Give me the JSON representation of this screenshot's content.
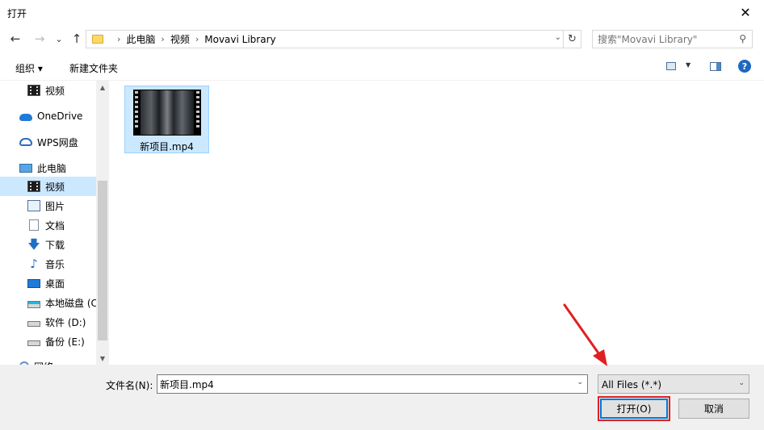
{
  "window": {
    "title": "打开",
    "close_glyph": "✕"
  },
  "nav": {
    "back_glyph": "←",
    "forward_glyph": "→",
    "recent_glyph": "⌄",
    "up_glyph": "↑",
    "breadcrumbs": [
      "此电脑",
      "视频",
      "Movavi Library"
    ],
    "refresh_glyph": "↻"
  },
  "search": {
    "placeholder": "搜索\"Movavi Library\"",
    "icon": "search-icon"
  },
  "toolbar": {
    "organize_label": "组织 ▾",
    "new_folder_label": "新建文件夹",
    "help_glyph": "?"
  },
  "sidebar": {
    "items": [
      {
        "label": "视频",
        "icon": "video-icon"
      },
      {
        "label": "OneDrive",
        "icon": "cloud-icon"
      },
      {
        "label": "WPS网盘",
        "icon": "wps-cloud-icon"
      },
      {
        "label": "此电脑",
        "icon": "computer-icon"
      },
      {
        "label": "视频",
        "icon": "video-icon",
        "selected": true
      },
      {
        "label": "图片",
        "icon": "pictures-icon"
      },
      {
        "label": "文档",
        "icon": "documents-icon"
      },
      {
        "label": "下载",
        "icon": "download-icon"
      },
      {
        "label": "音乐",
        "icon": "music-icon"
      },
      {
        "label": "桌面",
        "icon": "desktop-icon"
      },
      {
        "label": "本地磁盘 (C",
        "icon": "drive-c-icon"
      },
      {
        "label": "软件 (D:)",
        "icon": "drive-icon"
      },
      {
        "label": "备份 (E:)",
        "icon": "drive-icon"
      },
      {
        "label": "网络",
        "icon": "network-icon"
      }
    ]
  },
  "files": [
    {
      "name": "新项目.mp4",
      "icon": "video-thumbnail",
      "selected": true
    }
  ],
  "footer": {
    "filename_label": "文件名(N):",
    "filename_value": "新项目.mp4",
    "filter_value": "All Files (*.*)",
    "open_label": "打开(O)",
    "cancel_label": "取消"
  },
  "colors": {
    "selection": "#cce8ff",
    "accent": "#0078d7",
    "annotation": "#e02020"
  }
}
